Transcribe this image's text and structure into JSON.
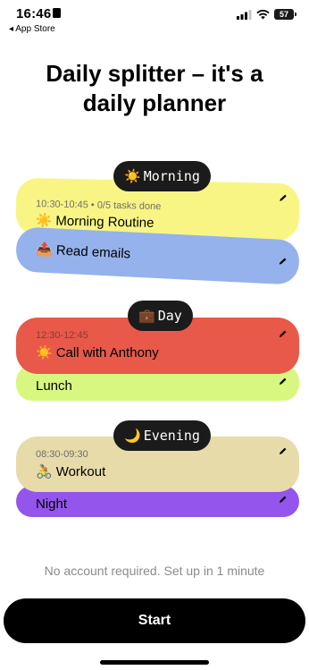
{
  "status_bar": {
    "time": "16:46",
    "back_label": "◂ App Store",
    "battery": "57"
  },
  "title_line1": "Daily splitter – it's a",
  "title_line2": "daily planner",
  "sections": {
    "morning": {
      "label": "Morning",
      "emoji": "☀️",
      "cards": [
        {
          "meta": "10:30-10:45 • 0/5 tasks done",
          "emoji": "☀️",
          "title": "Morning Routine",
          "color": "#f8f584"
        },
        {
          "emoji": "📤",
          "title": "Read emails",
          "color": "#95b2ec"
        }
      ]
    },
    "day": {
      "label": "Day",
      "emoji": "💼",
      "cards": [
        {
          "meta": "12:30-12:45",
          "emoji": "☀️",
          "title": "Call with Anthony",
          "color": "#e8594a"
        },
        {
          "title": "Lunch",
          "color": "#d7f781"
        }
      ]
    },
    "evening": {
      "label": "Evening",
      "emoji": "🌙",
      "cards": [
        {
          "meta": "08:30-09:30",
          "emoji": "🚴",
          "title": "Workout",
          "color": "#e7dba9"
        },
        {
          "title": "Night",
          "color": "#9355ec"
        }
      ]
    }
  },
  "footer_note": "No account required. Set up in 1 minute",
  "start_label": "Start"
}
